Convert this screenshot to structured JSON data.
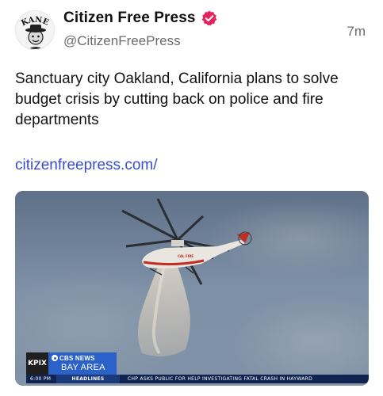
{
  "post": {
    "display_name": "Citizen Free Press",
    "handle": "@CitizenFreePress",
    "time": "7m",
    "text": "Sanctuary city Oakland, California plans to solve budget crisis by cutting back on police and fire departments",
    "link": "citizenfreepress.com/",
    "avatar_text": "KANE",
    "verified_icon": "verified-badge-icon",
    "colors": {
      "verified": "#e0245e",
      "link": "#3b4cc9",
      "secondary_text": "#6b6b6b"
    }
  },
  "media": {
    "station": "KPIX",
    "brand_line1": "CBS NEWS",
    "brand_line2": "BAY AREA",
    "ticker_time": "6:00 PM",
    "ticker_heading": "HEADLINES",
    "ticker_text": "CHP ASKS PUBLIC FOR HELP INVESTIGATING FATAL CRASH IN HAYWARD",
    "helicopter_livery": "CAL FIRE"
  }
}
